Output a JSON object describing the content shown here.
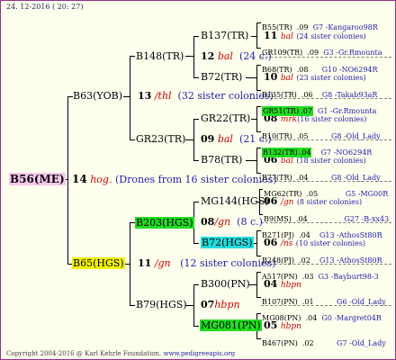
{
  "date": "24. 12-2016 ( 20: 27)",
  "copyright": "Copyright 2004-2016 @ Karl Kehrle Foundation.",
  "website": "www.pedigreeapis.org",
  "root": {
    "name": "B56(ME)",
    "num": "14",
    "sym": "hog.",
    "desc": "(Drones from 16 sister colonies)"
  },
  "sire": {
    "name": "B63(YOB)",
    "num": "13",
    "sym": "/thl",
    "desc": "(32 sister colonies)"
  },
  "dam": {
    "name": "B65(HGS)",
    "num": "11",
    "sym": "/gn",
    "desc": "(12 sister colonies)"
  },
  "gen2": {
    "b148": {
      "name": "B148(TR)",
      "num": "12",
      "sym": "bal",
      "desc": "(24 c.)"
    },
    "gr23": {
      "name": "GR23(TR)",
      "num": "09",
      "sym": "bal",
      "desc": "(21 c.)"
    },
    "b203": {
      "name": "B203(HGS)",
      "num": "08",
      "sym": "/gn",
      "desc": "(8 c.)"
    },
    "b79": {
      "name": "B79(HGS)",
      "num": "07",
      "sym": "hbpn",
      "desc": ""
    }
  },
  "gen3": {
    "b137": {
      "name": "B137(TR)",
      "num": "11",
      "sym": "bal",
      "desc": "(24 sister colonies)"
    },
    "b72tr": {
      "name": "B72(TR)",
      "num": "10",
      "sym": "bal",
      "desc": "(23 sister colonies)"
    },
    "gr22": {
      "name": "GR22(TR)",
      "num": "08",
      "sym": "mrk",
      "desc": "(16 sister colonies)"
    },
    "b78": {
      "name": "B78(TR)",
      "num": "06",
      "sym": "bal",
      "desc": "(18 sister colonies)"
    },
    "mg144": {
      "name": "MG144(HGS)",
      "num": "06",
      "sym": "/gn",
      "desc": "(8 sister colonies)"
    },
    "b72hgs": {
      "name": "B72(HGS)",
      "num": "06",
      "sym": "/ns",
      "desc": "(10 sister colonies)"
    },
    "b300": {
      "name": "B300(PN)",
      "num": "04",
      "sym": "hbpn",
      "desc": ""
    },
    "mg081": {
      "name": "MG081(PN)",
      "num": "05",
      "sym": "hbpn",
      "desc": ""
    }
  },
  "gen4": [
    {
      "name": "B55(TR)",
      "val": ".09",
      "info": "G7 -Kangaroo98R"
    },
    {
      "name": "GR109(TR)",
      "val": ".09",
      "info": "G3 -Gr.Rmounta"
    },
    {
      "name": "B68(TR)",
      "val": ".08",
      "info": "G10 -NO6294R"
    },
    {
      "name": "B135(TR)",
      "val": ".06",
      "info": "G8 -Takab93aR"
    },
    {
      "name": "GR51(TR)",
      "val": ".07",
      "info": "G1 -Gr.Rmounta"
    },
    {
      "name": "B10(TR)",
      "val": ".05",
      "info": "G8 -Old_Lady"
    },
    {
      "name": "B132(TR)",
      "val": ".04",
      "info": "G7 -NO6294R"
    },
    {
      "name": "B77(TR)",
      "val": ".04",
      "info": "G8 -Old_Lady"
    },
    {
      "name": "MG62(TR)",
      "val": ".05",
      "info": "G5 -MG00R"
    },
    {
      "name": "B9(MS)",
      "val": ".04",
      "info": "G27 -B-xx43"
    },
    {
      "name": "B271(PJ)",
      "val": ".04",
      "info": "G13 -AthosSt80R"
    },
    {
      "name": "B248(PJ)",
      "val": ".02",
      "info": "G13 -AthosSt80R"
    },
    {
      "name": "A517(PN)",
      "val": ".03",
      "info": "G3 -Bayburt98-3"
    },
    {
      "name": "B107(PN)",
      "val": ".01",
      "info": "G6 -Old_Lady"
    },
    {
      "name": "MG08(PN)",
      "val": ".04",
      "info": "G0 -Margret04R"
    },
    {
      "name": "B467(PN)",
      "val": ".02",
      "info": "G7 -Old_Lady"
    }
  ],
  "colors": {
    "border": "#9a2f8a",
    "background": "#ffffee",
    "green": "#22dd22",
    "yellow": "#f2f200",
    "cyan": "#22dddd",
    "pink": "#f7c7ee",
    "symbol": "#d00000",
    "info": "#2020aa"
  }
}
